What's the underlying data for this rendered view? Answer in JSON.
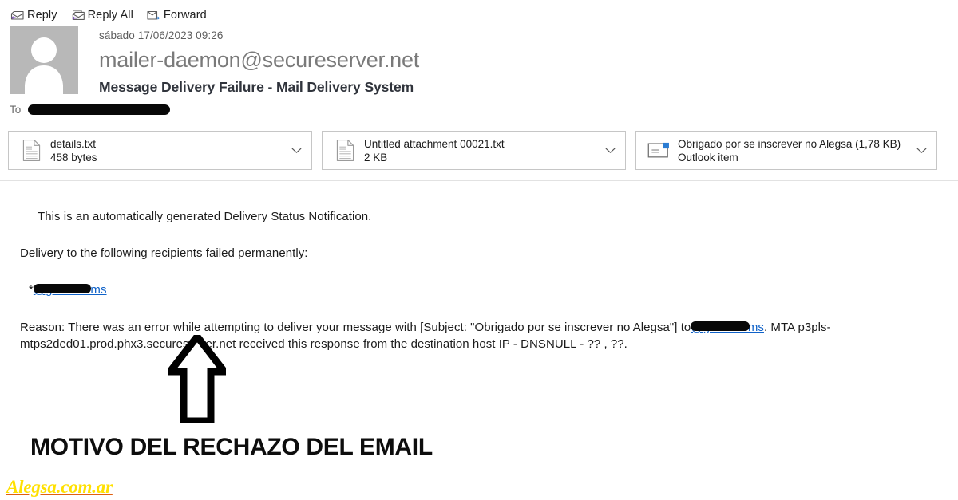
{
  "toolbar": {
    "reply": {
      "label": "Reply",
      "icon": "reply-icon"
    },
    "reply_all": {
      "label": "Reply All",
      "icon": "reply-all-icon"
    },
    "forward": {
      "label": "Forward",
      "icon": "forward-icon"
    }
  },
  "header": {
    "datetime": "sábado 17/06/2023 09:26",
    "sender": "mailer-daemon@secureserver.net",
    "subject": "Message Delivery Failure - Mail Delivery System",
    "to_label": "To",
    "to_value": "",
    "avatar_icon": "person-avatar-icon"
  },
  "attachments": [
    {
      "name": "details.txt",
      "meta": "458 bytes",
      "icon": "text-file-icon",
      "chevron": "chevron-down-icon"
    },
    {
      "name": "Untitled attachment 00021.txt",
      "meta": "2 KB",
      "icon": "text-file-icon",
      "chevron": "chevron-down-icon"
    },
    {
      "name": "Obrigado por se inscrever no Alegsa (1,78 KB)",
      "meta": "Outlook item",
      "icon": "outlook-item-icon",
      "chevron": "chevron-down-icon"
    }
  ],
  "message_body": {
    "intro": "This is an automatically generated Delivery Status Notification.",
    "delivery_line": "Delivery to the following recipients failed permanently:",
    "recipient_bullet": "*",
    "recipient_link": "@gmail.coms",
    "reason_part1": "Reason: There was an error while attempting to deliver your message with [Subject: \"Obrigado por se inscrever no Alegsa\"] to",
    "reason_link": "@gmail.coms",
    "reason_part2": ". MTA p3pls-mtps2ded01.prod.phx3.secureserver.net received this response from the destination host IP - DNSNULL -  ?? , ??."
  },
  "annotation": {
    "arrow_icon": "up-arrow-annotation-icon",
    "caption": "MOTIVO DEL RECHAZO DEL EMAIL",
    "watermark": "Alegsa.com.ar"
  },
  "colors": {
    "link": "#0f62c9",
    "sender_gray": "#7a7a7a",
    "subject_dark": "#30343c",
    "watermark_yellow": "#ffe000",
    "watermark_underline": "#e06010",
    "accent_purple": "#7a52b3",
    "accent_blue": "#2b7cd3"
  }
}
